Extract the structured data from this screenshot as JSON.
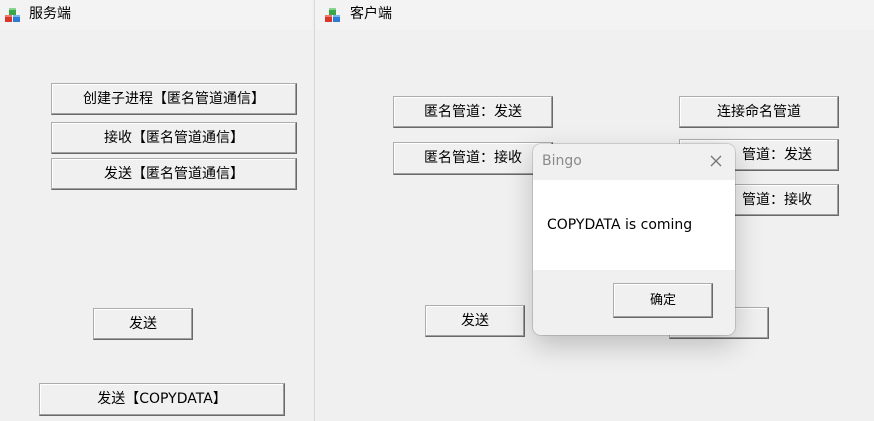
{
  "server": {
    "title": "服务端",
    "buttons": {
      "create_child": "创建子进程【匿名管道通信】",
      "receive_anon": "接收【匿名管道通信】",
      "send_anon": "发送【匿名管道通信】",
      "send": "发送",
      "send_copydata": "发送【COPYDATA】"
    }
  },
  "client": {
    "title": "客户端",
    "buttons": {
      "anon_send": "匿名管道：发送",
      "anon_receive": "匿名管道：接收",
      "named_connect": "连接命名管道",
      "named_send_partial": "管道：发送",
      "named_receive_partial": "管道：接收",
      "send": "发送"
    }
  },
  "dialog": {
    "title": "Bingo",
    "message": "COPYDATA is coming",
    "ok_label": "确定"
  },
  "icons": {
    "app": "app-cubes-icon",
    "close": "close-icon"
  }
}
